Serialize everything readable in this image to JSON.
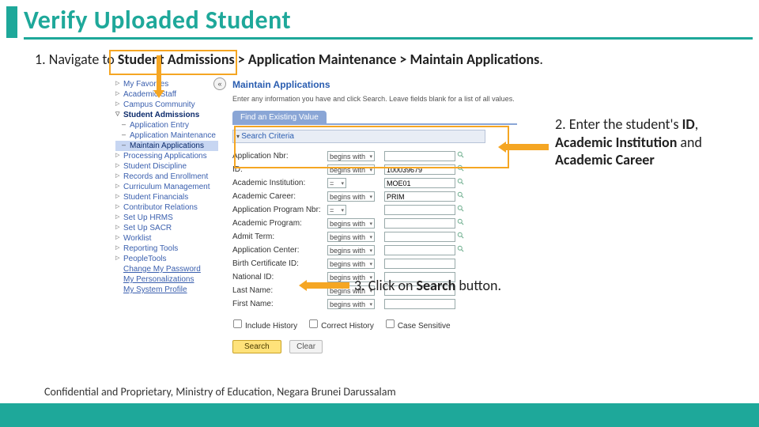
{
  "title": "Verify Uploaded Student",
  "step1_prefix": "1. Navigate to ",
  "step1_path": "Student Admissions > Application Maintenance > Maintain Applications",
  "step1_suffix": ".",
  "nav": {
    "items": [
      "My Favorites",
      "Academic Staff",
      "Campus Community",
      "Student Financials",
      "Contributor Relations",
      "Set Up HRMS",
      "Set Up SACR",
      "Worklist",
      "Reporting Tools",
      "PeopleTools"
    ],
    "student_admissions": "Student Admissions",
    "application_entry": "Application Entry",
    "application_maintenance": "Application Maintenance",
    "maintain_applications": "Maintain Applications",
    "processing": "Processing Applications",
    "student_discipline": "Student Discipline",
    "records": "Records and Enrollment",
    "curriculum": "Curriculum Management",
    "fin": "Student Financials",
    "contrib": "Contributor Relations",
    "hrms": "Set Up HRMS",
    "sacr": "Set Up SACR",
    "worklist": "Worklist",
    "reporting": "Reporting Tools",
    "people": "PeopleTools",
    "change_pw": "Change My Password",
    "my_pers": "My Personalizations",
    "my_sys": "My System Profile",
    "fav": "My Favorites",
    "acad_staff": "Academic Staff",
    "campus": "Campus Community",
    "collapse": "«"
  },
  "main": {
    "title": "Maintain Applications",
    "sub": "Enter any information you have and click Search. Leave fields blank for a list of all values.",
    "tab": "Find an Existing Value",
    "criteria": "Search Criteria",
    "rows": [
      {
        "label": "Application Nbr:",
        "op": "begins with",
        "val": ""
      },
      {
        "label": "ID:",
        "op": "begins with",
        "val": "100039679"
      },
      {
        "label": "Academic Institution:",
        "op": "=",
        "val": "MOE01"
      },
      {
        "label": "Academic Career:",
        "op": "begins with",
        "val": "PRIM"
      },
      {
        "label": "Application Program Nbr:",
        "op": "=",
        "val": ""
      },
      {
        "label": "Academic Program:",
        "op": "begins with",
        "val": ""
      },
      {
        "label": "Admit Term:",
        "op": "begins with",
        "val": ""
      },
      {
        "label": "Application Center:",
        "op": "begins with",
        "val": ""
      },
      {
        "label": "Birth Certificate ID:",
        "op": "begins with",
        "val": ""
      },
      {
        "label": "National ID:",
        "op": "begins with",
        "val": ""
      },
      {
        "label": "Last Name:",
        "op": "begins with",
        "val": ""
      },
      {
        "label": "First Name:",
        "op": "begins with",
        "val": ""
      }
    ],
    "checks": [
      "Include History",
      "Correct History",
      "Case Sensitive"
    ],
    "search": "Search",
    "clear": "Clear"
  },
  "step2_pre": "2. Enter the student's ",
  "step2_b1": "ID",
  "step2_mid1": ", ",
  "step2_b2": "Academic Institution",
  "step2_mid2": " and ",
  "step2_b3": "Academic Career",
  "step3_pre": "3. Click on ",
  "step3_b": "Search",
  "step3_post": " button.",
  "footer": "Confidential and Proprietary, Ministry of Education, Negara Brunei Darussalam"
}
